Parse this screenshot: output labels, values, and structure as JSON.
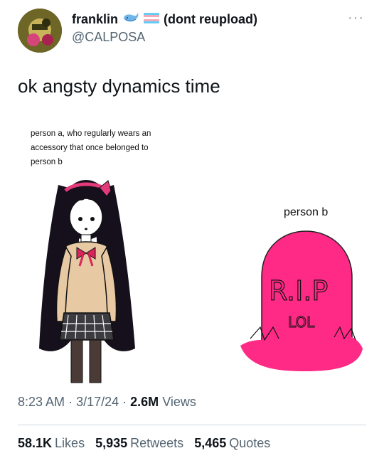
{
  "user": {
    "display_name": "franklin",
    "badges_text": "(dont reupload)",
    "handle": "@CALPOSA",
    "icons": [
      "whale-emoji-icon",
      "transgender-flag-icon"
    ]
  },
  "tweet": {
    "text": "ok angsty dynamics time"
  },
  "media": {
    "caption_a": "person a, who regularly wears an accessory that once belonged to person b",
    "caption_b": "person b",
    "tombstone_text_1": "R.I.P",
    "tombstone_text_2": "LOL",
    "colors": {
      "tombstone": "#ff2a86",
      "bow": "#d8265a"
    }
  },
  "meta": {
    "time": "8:23 AM",
    "date": "3/17/24",
    "views_count": "2.6M",
    "views_label": "Views"
  },
  "stats": {
    "likes_count": "58.1K",
    "likes_label": "Likes",
    "retweets_count": "5,935",
    "retweets_label": "Retweets",
    "quotes_count": "5,465",
    "quotes_label": "Quotes"
  }
}
